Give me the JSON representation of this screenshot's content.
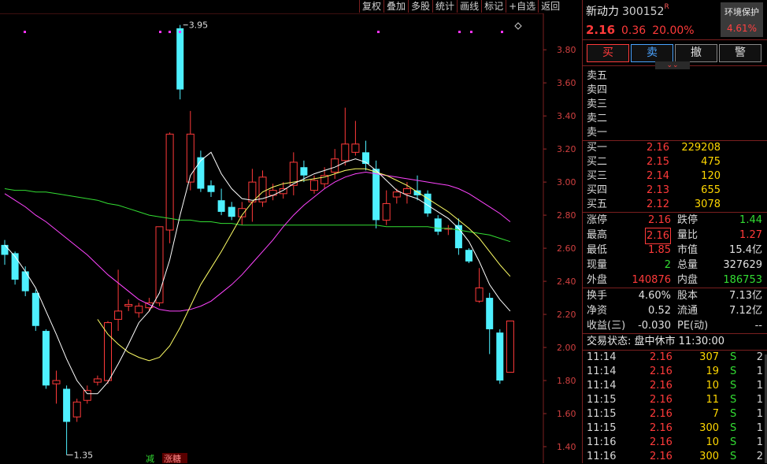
{
  "toolbar": [
    "复权",
    "叠加",
    "多股",
    "统计",
    "画线",
    "标记",
    "+自选",
    "返回"
  ],
  "stock": {
    "name": "新动力",
    "code": "300152",
    "badge": "R",
    "price": "2.16",
    "change": "0.36",
    "pct": "20.00%"
  },
  "env": {
    "label": "环境保护",
    "value": "4.61%"
  },
  "trade_buttons": {
    "buy": "买",
    "sell": "卖",
    "cancel": "撤",
    "alert": "警"
  },
  "expand_icon": "chevron-double-down-icon",
  "asks": [
    {
      "label": "卖五",
      "price": "",
      "vol": ""
    },
    {
      "label": "卖四",
      "price": "",
      "vol": ""
    },
    {
      "label": "卖三",
      "price": "",
      "vol": ""
    },
    {
      "label": "卖二",
      "price": "",
      "vol": ""
    },
    {
      "label": "卖一",
      "price": "",
      "vol": ""
    }
  ],
  "bids": [
    {
      "label": "买一",
      "price": "2.16",
      "vol": "229208"
    },
    {
      "label": "买二",
      "price": "2.15",
      "vol": "475"
    },
    {
      "label": "买三",
      "price": "2.14",
      "vol": "120"
    },
    {
      "label": "买四",
      "price": "2.13",
      "vol": "655"
    },
    {
      "label": "买五",
      "price": "2.12",
      "vol": "3078"
    }
  ],
  "stats": [
    {
      "k1": "涨停",
      "v1": "2.16",
      "c1": "red",
      "k2": "跌停",
      "v2": "1.44",
      "c2": "green"
    },
    {
      "k1": "最高",
      "v1": "2.16",
      "c1": "red",
      "k2": "量比",
      "v2": "1.27",
      "c2": "red"
    },
    {
      "k1": "最低",
      "v1": "1.85",
      "c1": "red",
      "k2": "市值",
      "v2": "15.4亿",
      "c2": "white"
    },
    {
      "k1": "现量",
      "v1": "2",
      "c1": "green",
      "k2": "总量",
      "v2": "327629",
      "c2": "white"
    },
    {
      "k1": "外盘",
      "v1": "140876",
      "c1": "red",
      "k2": "内盘",
      "v2": "186753",
      "c2": "green"
    }
  ],
  "stats2": [
    {
      "k1": "换手",
      "v1": "4.60%",
      "k2": "股本",
      "v2": "7.13亿"
    },
    {
      "k1": "净资",
      "v1": "0.52",
      "k2": "流通",
      "v2": "7.12亿"
    },
    {
      "k1": "收益(三)",
      "v1": "-0.030",
      "k2": "PE(动)",
      "v2": "--"
    }
  ],
  "status": "交易状态: 盘中休市 11:30:00",
  "ticks": [
    {
      "time": "11:14",
      "price": "2.16",
      "vol": "307",
      "flag": "S",
      "n": "2"
    },
    {
      "time": "11:14",
      "price": "2.16",
      "vol": "19",
      "flag": "S",
      "n": "1"
    },
    {
      "time": "11:14",
      "price": "2.16",
      "vol": "10",
      "flag": "S",
      "n": "1"
    },
    {
      "time": "11:15",
      "price": "2.16",
      "vol": "11",
      "flag": "S",
      "n": "1"
    },
    {
      "time": "11:15",
      "price": "2.16",
      "vol": "7",
      "flag": "S",
      "n": "1"
    },
    {
      "time": "11:15",
      "price": "2.16",
      "vol": "300",
      "flag": "S",
      "n": "1"
    },
    {
      "time": "11:16",
      "price": "2.16",
      "vol": "10",
      "flag": "S",
      "n": "1"
    },
    {
      "time": "11:16",
      "price": "2.16",
      "vol": "300",
      "flag": "S",
      "n": "2"
    }
  ],
  "chart_data": {
    "type": "candlestick",
    "y_ticks": [
      "3.80",
      "3.60",
      "3.40",
      "3.20",
      "3.00",
      "2.80",
      "2.60",
      "2.40",
      "2.20",
      "2.00",
      "1.80",
      "1.60",
      "1.40"
    ],
    "ylim": [
      1.3,
      4.02
    ],
    "high_label": "3.95",
    "low_label": "1.35",
    "bottom_tags": [
      "减",
      "涨糖"
    ],
    "colors": {
      "up": "#ff3a3a",
      "down": "#4ef0ff",
      "ma5": "#ffffff",
      "ma10": "#ffff66",
      "ma20": "#ff44ff",
      "ma60": "#33dd33"
    },
    "candles": [
      {
        "o": 2.62,
        "c": 2.56,
        "h": 2.65,
        "l": 2.5
      },
      {
        "o": 2.57,
        "c": 2.41,
        "h": 2.58,
        "l": 2.38
      },
      {
        "o": 2.46,
        "c": 2.34,
        "h": 2.49,
        "l": 2.31
      },
      {
        "o": 2.33,
        "c": 2.13,
        "h": 2.35,
        "l": 2.1
      },
      {
        "o": 2.1,
        "c": 1.77,
        "h": 2.11,
        "l": 1.75
      },
      {
        "o": 1.78,
        "c": 1.8,
        "h": 1.86,
        "l": 1.66
      },
      {
        "o": 1.75,
        "c": 1.55,
        "h": 1.77,
        "l": 1.35
      },
      {
        "o": 1.58,
        "c": 1.67,
        "h": 1.69,
        "l": 1.55
      },
      {
        "o": 1.68,
        "c": 1.74,
        "h": 1.77,
        "l": 1.66
      },
      {
        "o": 1.79,
        "c": 1.81,
        "h": 1.83,
        "l": 1.77
      },
      {
        "o": 1.8,
        "c": 2.15,
        "h": 2.16,
        "l": 1.78
      },
      {
        "o": 2.17,
        "c": 2.22,
        "h": 2.47,
        "l": 2.1
      },
      {
        "o": 2.25,
        "c": 2.26,
        "h": 2.29,
        "l": 2.22
      },
      {
        "o": 2.21,
        "c": 2.25,
        "h": 2.27,
        "l": 2.18
      },
      {
        "o": 2.24,
        "c": 2.27,
        "h": 2.3,
        "l": 2.22
      },
      {
        "o": 2.27,
        "c": 2.73,
        "h": 2.73,
        "l": 2.25
      },
      {
        "o": 2.71,
        "c": 3.29,
        "h": 3.3,
        "l": 2.63
      },
      {
        "o": 3.93,
        "c": 3.56,
        "h": 3.95,
        "l": 3.5
      },
      {
        "o": 3.0,
        "c": 3.29,
        "h": 3.43,
        "l": 2.95
      },
      {
        "o": 3.15,
        "c": 2.96,
        "h": 3.19,
        "l": 2.94
      },
      {
        "o": 2.98,
        "c": 2.94,
        "h": 3.01,
        "l": 2.91
      },
      {
        "o": 2.89,
        "c": 2.82,
        "h": 2.96,
        "l": 2.8
      },
      {
        "o": 2.85,
        "c": 2.79,
        "h": 2.88,
        "l": 2.77
      },
      {
        "o": 2.79,
        "c": 2.84,
        "h": 2.88,
        "l": 2.74
      },
      {
        "o": 2.88,
        "c": 3.0,
        "h": 3.08,
        "l": 2.76
      },
      {
        "o": 2.88,
        "c": 3.03,
        "h": 3.07,
        "l": 2.85
      },
      {
        "o": 2.92,
        "c": 2.95,
        "h": 2.99,
        "l": 2.89
      },
      {
        "o": 2.93,
        "c": 2.96,
        "h": 3.0,
        "l": 2.9
      },
      {
        "o": 2.98,
        "c": 3.12,
        "h": 3.18,
        "l": 2.92
      },
      {
        "o": 3.09,
        "c": 3.04,
        "h": 3.13,
        "l": 3.0
      },
      {
        "o": 2.95,
        "c": 3.01,
        "h": 3.04,
        "l": 2.93
      },
      {
        "o": 2.99,
        "c": 3.04,
        "h": 3.09,
        "l": 2.96
      },
      {
        "o": 3.06,
        "c": 3.14,
        "h": 3.2,
        "l": 3.02
      },
      {
        "o": 3.13,
        "c": 3.23,
        "h": 3.45,
        "l": 3.1
      },
      {
        "o": 3.18,
        "c": 3.23,
        "h": 3.37,
        "l": 3.16
      },
      {
        "o": 3.18,
        "c": 3.11,
        "h": 3.25,
        "l": 3.07
      },
      {
        "o": 3.08,
        "c": 2.77,
        "h": 3.13,
        "l": 2.72
      },
      {
        "o": 2.77,
        "c": 2.87,
        "h": 2.95,
        "l": 2.74
      },
      {
        "o": 2.91,
        "c": 2.94,
        "h": 2.96,
        "l": 2.87
      },
      {
        "o": 2.93,
        "c": 2.96,
        "h": 3.0,
        "l": 2.87
      },
      {
        "o": 2.95,
        "c": 2.92,
        "h": 3.04,
        "l": 2.89
      },
      {
        "o": 2.93,
        "c": 2.81,
        "h": 2.95,
        "l": 2.79
      },
      {
        "o": 2.78,
        "c": 2.7,
        "h": 2.8,
        "l": 2.68
      },
      {
        "o": 2.72,
        "c": 2.72,
        "h": 2.74,
        "l": 2.68
      },
      {
        "o": 2.74,
        "c": 2.6,
        "h": 2.78,
        "l": 2.56
      },
      {
        "o": 2.59,
        "c": 2.52,
        "h": 2.6,
        "l": 2.51
      },
      {
        "o": 2.28,
        "c": 2.36,
        "h": 2.48,
        "l": 2.27
      },
      {
        "o": 2.3,
        "c": 2.11,
        "h": 2.33,
        "l": 1.96
      },
      {
        "o": 2.09,
        "c": 1.8,
        "h": 2.11,
        "l": 1.78
      },
      {
        "o": 1.85,
        "c": 2.16,
        "h": 2.16,
        "l": 1.85
      }
    ],
    "ma5": [
      2.62,
      2.55,
      2.46,
      2.36,
      2.22,
      2.08,
      1.93,
      1.8,
      1.72,
      1.72,
      1.79,
      1.9,
      2.02,
      2.15,
      2.22,
      2.33,
      2.53,
      2.8,
      3.04,
      3.13,
      3.18,
      3.05,
      2.96,
      2.9,
      2.89,
      2.9,
      2.92,
      2.95,
      2.99,
      3.02,
      3.05,
      3.07,
      3.09,
      3.12,
      3.14,
      3.12,
      3.07,
      3.01,
      2.95,
      2.92,
      2.9,
      2.86,
      2.82,
      2.78,
      2.72,
      2.64,
      2.52,
      2.38,
      2.29,
      2.22
    ],
    "ma10": [
      null,
      null,
      null,
      null,
      null,
      null,
      null,
      null,
      null,
      2.17,
      2.08,
      2.02,
      1.97,
      1.94,
      1.92,
      1.94,
      2.01,
      2.12,
      2.25,
      2.38,
      2.48,
      2.58,
      2.69,
      2.8,
      2.88,
      2.94,
      2.97,
      2.99,
      3.0,
      3.01,
      3.02,
      3.03,
      3.05,
      3.07,
      3.08,
      3.08,
      3.06,
      3.04,
      3.01,
      2.98,
      2.94,
      2.9,
      2.86,
      2.82,
      2.77,
      2.72,
      2.66,
      2.58,
      2.5,
      2.43
    ],
    "ma20": [
      2.93,
      2.89,
      2.85,
      2.8,
      2.76,
      2.71,
      2.66,
      2.61,
      2.56,
      2.5,
      2.44,
      2.39,
      2.34,
      2.29,
      2.26,
      2.23,
      2.22,
      2.22,
      2.23,
      2.25,
      2.28,
      2.33,
      2.38,
      2.44,
      2.51,
      2.58,
      2.65,
      2.73,
      2.8,
      2.86,
      2.91,
      2.96,
      3.0,
      3.03,
      3.05,
      3.06,
      3.05,
      3.04,
      3.03,
      3.02,
      3.01,
      3.0,
      2.99,
      2.98,
      2.96,
      2.93,
      2.89,
      2.85,
      2.81,
      2.76
    ],
    "ma60": [
      2.96,
      2.95,
      2.95,
      2.94,
      2.94,
      2.93,
      2.92,
      2.91,
      2.9,
      2.89,
      2.87,
      2.86,
      2.84,
      2.82,
      2.8,
      2.79,
      2.78,
      2.77,
      2.77,
      2.76,
      2.76,
      2.75,
      2.75,
      2.74,
      2.74,
      2.74,
      2.74,
      2.74,
      2.74,
      2.74,
      2.74,
      2.74,
      2.74,
      2.74,
      2.74,
      2.74,
      2.74,
      2.73,
      2.73,
      2.73,
      2.73,
      2.73,
      2.72,
      2.72,
      2.71,
      2.7,
      2.69,
      2.68,
      2.66,
      2.64
    ]
  }
}
